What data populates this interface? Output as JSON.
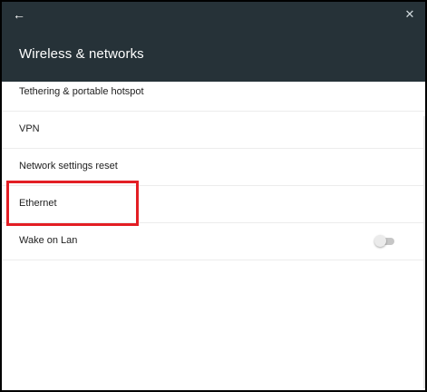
{
  "appbar": {
    "back_icon": "arrow-left-icon",
    "close_icon": "close-icon",
    "title": "Wireless & networks"
  },
  "settings": {
    "items": [
      {
        "label": "Tethering & portable hotspot"
      },
      {
        "label": "VPN"
      },
      {
        "label": "Network settings reset"
      },
      {
        "label": "Ethernet",
        "highlighted": true
      },
      {
        "label": "Wake on Lan",
        "has_toggle": true,
        "toggle_on": false
      }
    ]
  },
  "colors": {
    "appbar_bg": "#263238",
    "highlight": "#e31e24",
    "toggle_track": "#c6c6c6",
    "toggle_thumb": "#ebebeb"
  }
}
